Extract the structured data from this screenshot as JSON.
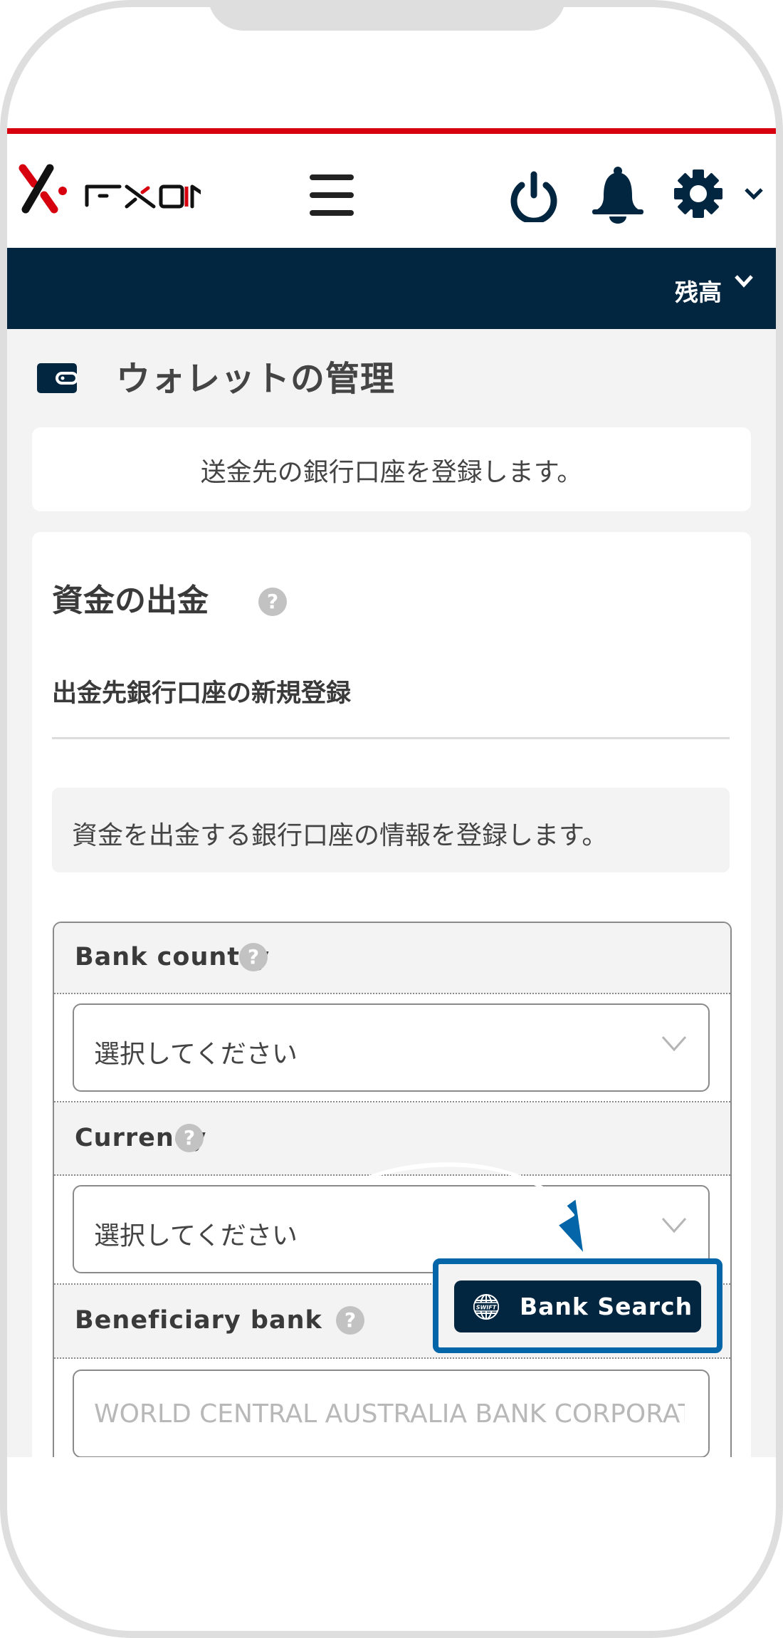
{
  "header": {
    "logo_text": "FXON",
    "menu_icon": "hamburger-icon",
    "icons": [
      "power-icon",
      "bell-icon",
      "gear-icon",
      "chevron-down-icon"
    ]
  },
  "navbar": {
    "balance_label": "残高"
  },
  "page": {
    "title": "ウォレットの管理",
    "title_icon": "wallet-icon",
    "info_text": "送金先の銀行口座を登録します。"
  },
  "section": {
    "title": "資金の出金",
    "subtitle": "出金先銀行口座の新規登録",
    "note": "資金を出金する銀行口座の情報を登録します。"
  },
  "form": {
    "fields": [
      {
        "label": "Bank country",
        "value": "選択してください",
        "type": "select"
      },
      {
        "label": "Currency",
        "value": "選択してください",
        "type": "select"
      },
      {
        "label": "Beneficiary bank",
        "placeholder": "WORLD CENTRAL AUSTRALIA BANK CORPORATION",
        "type": "text"
      }
    ],
    "bank_search_label": "Bank Search",
    "bank_search_icon": "swift-globe-icon"
  },
  "colors": {
    "brand_red": "#d7000f",
    "navy": "#022640",
    "highlight_blue": "#0466a8"
  }
}
